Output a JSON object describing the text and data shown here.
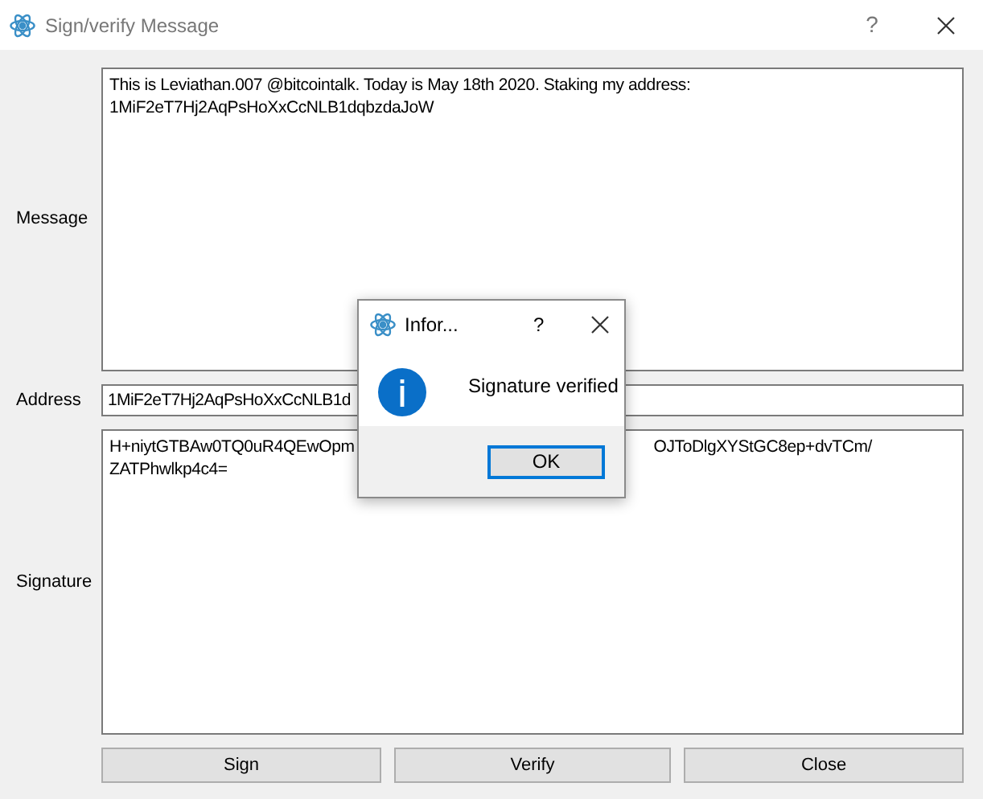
{
  "window": {
    "title": "Sign/verify Message",
    "help": "?"
  },
  "message": {
    "label": "Message",
    "lines": [
      "This is Leviathan.007 @bitcointalk. Today is May 18th 2020. Staking my address:",
      "1MiF2eT7Hj2AqPsHoXxCcNLB1dqbzdaJoW"
    ]
  },
  "address": {
    "label": "Address",
    "value": "1MiF2eT7Hj2AqPsHoXxCcNLB1d"
  },
  "signature": {
    "label": "Signature",
    "line_1_start": "H+niytGTBAw0TQ0uR4QEwOpm",
    "line_1_end": "OJToDlgXYStGC8ep+dvTCm/",
    "line_2": "ZATPhwlkp4c4="
  },
  "buttons": [
    "Sign",
    "Verify",
    "Close"
  ],
  "dialog": {
    "title": "Infor...",
    "help": "?",
    "text": "Signature verified",
    "button": "OK"
  }
}
